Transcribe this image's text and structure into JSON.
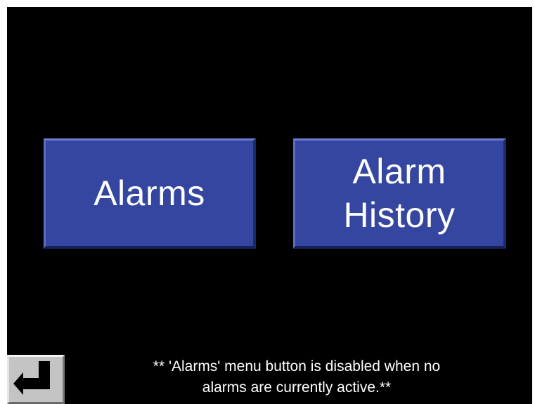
{
  "menu": {
    "alarms_label": "Alarms",
    "alarm_history_label": "Alarm\nHistory"
  },
  "footer": {
    "back_icon": "return-arrow-icon",
    "note_line1": "** 'Alarms' menu button is disabled when no",
    "note_line2": "alarms are currently active.**"
  },
  "colors": {
    "background": "#000000",
    "button_blue": "#3446a0",
    "button_text": "#ffffff",
    "back_button_gray": "#c4c4c4"
  }
}
